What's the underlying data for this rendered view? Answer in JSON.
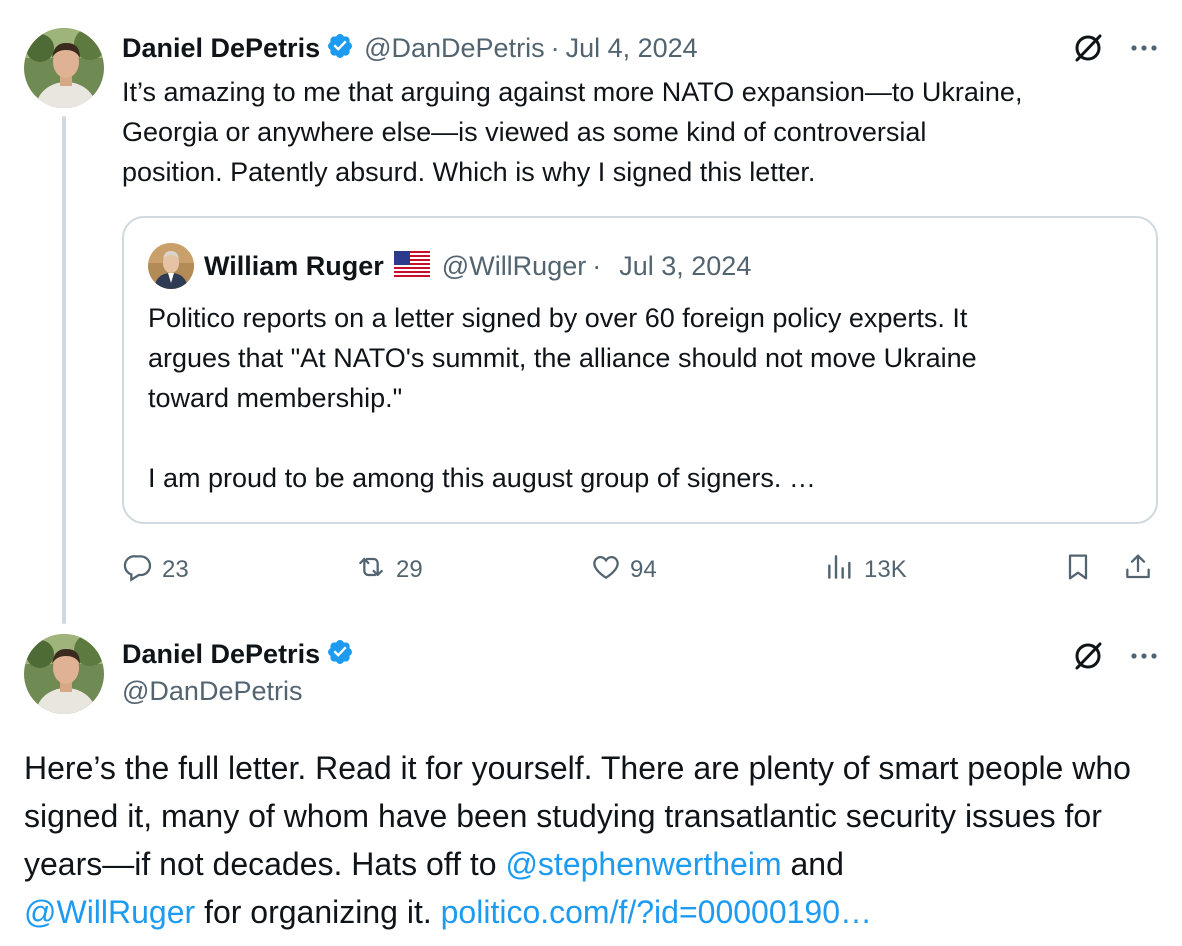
{
  "tweet1": {
    "author_name": "Daniel DePetris",
    "handle": "@DanDePetris",
    "separator": "·",
    "date": "Jul 4, 2024",
    "body": "It’s amazing to me that arguing against more NATO expansion—to Ukraine,\nGeorgia or anywhere else—is viewed as some kind of controversial\nposition. Patently absurd. Which is why I signed this letter.",
    "quote": {
      "author_name": "William Ruger",
      "handle": "@WillRuger",
      "separator": "·",
      "date": "Jul 3, 2024",
      "body": "Politico reports on a letter signed by over 60 foreign policy experts. It\nargues that \"At NATO's summit, the alliance should not move Ukraine\ntoward membership.\"\n\nI am proud to be among this august group of signers. …"
    },
    "actions": {
      "replies": "23",
      "reposts": "29",
      "likes": "94",
      "views": "13K"
    }
  },
  "tweet2": {
    "author_name": "Daniel DePetris",
    "handle": "@DanDePetris",
    "body_part1": "Here’s the full letter. Read it for yourself. There are plenty of smart people who signed it, many of whom have been studying transatlantic security issues for years—if not decades. Hats off to ",
    "mention1": "@stephenwertheim",
    "body_part2": " and ",
    "mention2": "@WillRuger",
    "body_part3": " for organizing it. ",
    "link": "politico.com/f/?id=00000190…"
  },
  "colors": {
    "text": "#0f1419",
    "secondary": "#536471",
    "accent": "#1d9bf0",
    "border": "#cfd9de"
  },
  "icons": [
    "verified-badge-icon",
    "grok-icon",
    "more-icon",
    "reply-icon",
    "repost-icon",
    "like-icon",
    "views-icon",
    "bookmark-icon",
    "share-icon",
    "us-flag-icon"
  ]
}
